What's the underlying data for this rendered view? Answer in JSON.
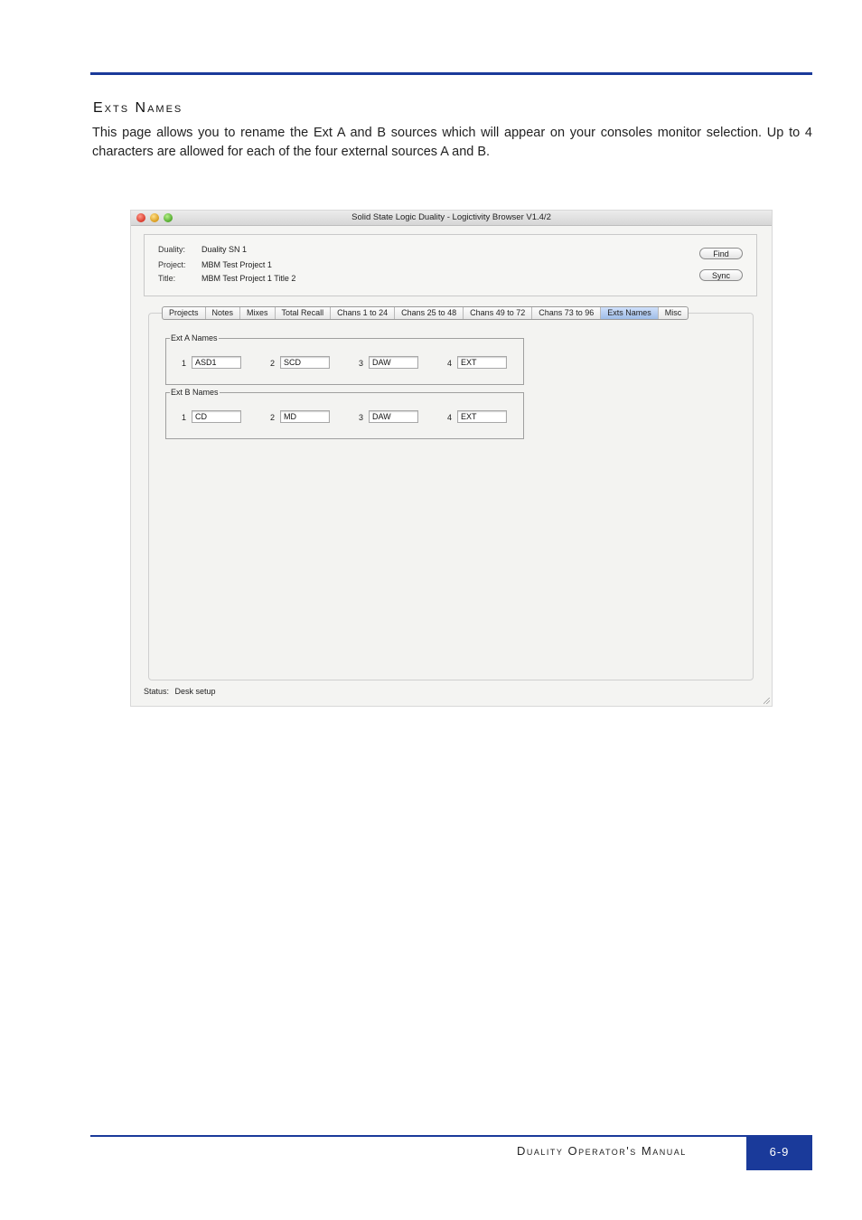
{
  "section": {
    "title": "Exts Names",
    "body": "This page allows you to rename the Ext A and B sources which will appear on your consoles monitor selection. Up to 4 characters are allowed for each of the four external sources A and B."
  },
  "window": {
    "title": "Solid State Logic Duality - Logictivity Browser V1.4/2",
    "info": [
      {
        "label": "Duality:",
        "value": "Duality SN 1"
      },
      {
        "label": "Project:",
        "value": "MBM Test Project 1"
      },
      {
        "label": "Title:",
        "value": "MBM Test Project 1 Title 2"
      }
    ],
    "buttons": {
      "find": "Find",
      "sync": "Sync"
    },
    "tabs": [
      "Projects",
      "Notes",
      "Mixes",
      "Total Recall",
      "Chans 1 to 24",
      "Chans 25 to 48",
      "Chans 49 to 72",
      "Chans 73 to 96",
      "Exts Names",
      "Misc"
    ],
    "active_tab": "Exts Names",
    "ext_a": {
      "label": "Ext A Names",
      "fields": [
        {
          "num": "1",
          "value": "ASD1"
        },
        {
          "num": "2",
          "value": "SCD"
        },
        {
          "num": "3",
          "value": "DAW"
        },
        {
          "num": "4",
          "value": "EXT"
        }
      ]
    },
    "ext_b": {
      "label": "Ext B Names",
      "fields": [
        {
          "num": "1",
          "value": "CD"
        },
        {
          "num": "2",
          "value": "MD"
        },
        {
          "num": "3",
          "value": "DAW"
        },
        {
          "num": "4",
          "value": "EXT"
        }
      ]
    },
    "status": {
      "label": "Status:",
      "value": "Desk setup"
    }
  },
  "footer": {
    "manual_title": "Duality Operator's Manual",
    "page_number": "6-9"
  },
  "colors": {
    "accent": "#1a3a9a",
    "active_tab": "#9fbde8"
  }
}
